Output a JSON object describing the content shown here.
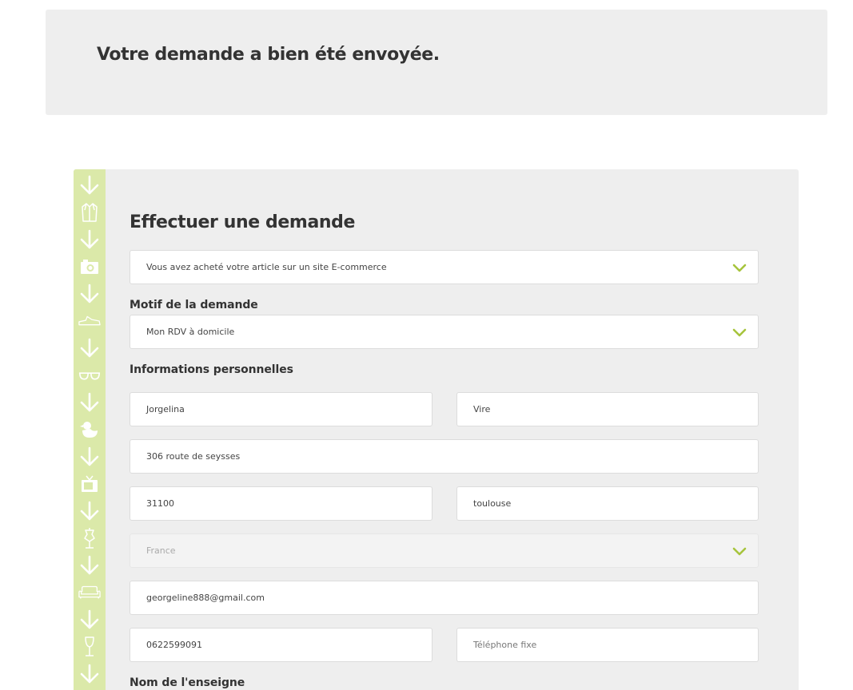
{
  "banner": {
    "message": "Votre demande a bien été envoyée."
  },
  "form": {
    "title": "Effectuer une demande",
    "purchase_channel": {
      "value": "Vous avez acheté votre article sur un site E-commerce"
    },
    "motif": {
      "label": "Motif de la demande",
      "value": "Mon RDV à domicile"
    },
    "personal": {
      "label": "Informations personnelles",
      "first_name": "Jorgelina",
      "last_name": "Vire",
      "address": "306 route de seysses",
      "postal_code": "31100",
      "city": "toulouse",
      "country": "France",
      "email": "georgeline888@gmail.com",
      "mobile": "0622599091",
      "landline_placeholder": "Téléphone fixe"
    },
    "store_label": "Nom de l'enseigne"
  },
  "colors": {
    "accent": "#a6c43c",
    "strip": "#dbe9a9",
    "panel": "#eeeeee"
  },
  "side_icons": [
    "arrow-down-icon",
    "coat-icon",
    "arrow-down-icon",
    "camera-icon",
    "arrow-down-icon",
    "shoe-icon",
    "arrow-down-icon",
    "glasses-icon",
    "arrow-down-icon",
    "duck-icon",
    "arrow-down-icon",
    "tv-icon",
    "arrow-down-icon",
    "mannequin-icon",
    "arrow-down-icon",
    "sofa-icon",
    "arrow-down-icon",
    "wine-glass-icon",
    "arrow-down-icon"
  ]
}
